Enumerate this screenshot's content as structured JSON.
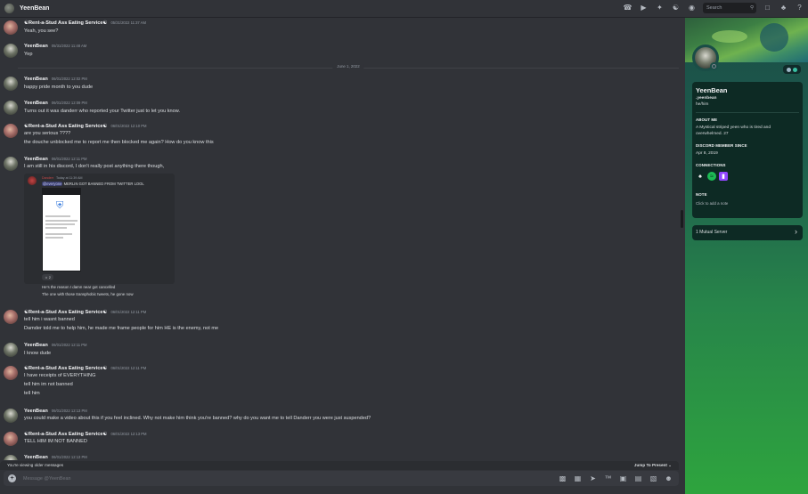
{
  "window": {
    "title": "YeenBean",
    "search_placeholder": "Search"
  },
  "header_icons": [
    "phone-icon",
    "video-icon",
    "pin-icon",
    "add-friend-icon",
    "profile-toggle-icon",
    "inbox-icon",
    "help-icon"
  ],
  "date_divider": "June 1, 2022",
  "messages": [
    {
      "author": "☯Rent-a-Stud Ass Eating Service☯",
      "time": "05/31/2022 11:37 AM",
      "lines": [
        "Yeah, you see?"
      ]
    },
    {
      "author": "YeenBean",
      "time": "05/31/2022 11:48 AM",
      "lines": [
        "Yep"
      ]
    },
    {
      "author": "YeenBean",
      "time": "06/01/2022 12:02 PM",
      "lines": [
        "happy pride month to you dude"
      ]
    },
    {
      "author": "YeenBean",
      "time": "06/01/2022 12:09 PM",
      "lines": [
        "Turns out it was danderr who reported your Twitter just to let you know."
      ]
    },
    {
      "author": "☯Rent-a-Stud Ass Eating Service☯",
      "time": "06/01/2022 12:10 PM",
      "lines": [
        "are you serious ????",
        "the douche unblocked me to report me then blocked me again? How do you know this"
      ]
    },
    {
      "author": "YeenBean",
      "time": "06/01/2022 12:11 PM",
      "lines": [
        "I am still in his discord, I don't really post anything there though,"
      ]
    },
    {
      "author": "☯Rent-a-Stud Ass Eating Service☯",
      "time": "06/01/2022 12:11 PM",
      "lines": [
        "tell him i wasnt banned",
        "Damder told me to help him, he made me frame people for him HE is the enemy, not me"
      ]
    },
    {
      "author": "YeenBean",
      "time": "06/01/2022 12:11 PM",
      "lines": [
        "I know dude"
      ]
    },
    {
      "author": "☯Rent-a-Stud Ass Eating Service☯",
      "time": "06/01/2022 12:11 PM",
      "lines": [
        "I have receipts of EVERYTHING",
        "tell him im not banned",
        "tell him"
      ]
    },
    {
      "author": "YeenBean",
      "time": "06/01/2022 12:13 PM",
      "lines": [
        "you could make a video about this if you feel inclined. Why not make him think you're banned? why do you want me to tell Danderr you were just suspended?"
      ]
    },
    {
      "author": "☯Rent-a-Stud Ass Eating Service☯",
      "time": "06/01/2022 12:13 PM",
      "lines": [
        "TELL HIM IM NOT BANNED"
      ]
    },
    {
      "author": "YeenBean",
      "time": "06/01/2022 12:13 PM",
      "lines": []
    }
  ],
  "embed": {
    "author": "Danderr",
    "time": "Today at 11:39 AM",
    "mention": "@everyone",
    "text": " MERLIN GOT BANNED FROM TWITTER LOOL",
    "reaction_count": "2",
    "caption1": "He's the reason I damn near got cancelled",
    "caption2": "The one with those transphobic tweets, he gone now"
  },
  "notice": {
    "text": "You're viewing older messages",
    "jump": "Jump To Present"
  },
  "composer": {
    "placeholder": "Message @YeenBean"
  },
  "profile": {
    "display_name": "YeenBean",
    "username": ".yeenbean",
    "pronouns": "he/him",
    "about_title": "ABOUT ME",
    "about": "A Mystical striped yeen who is tired and overwhelmed. 27",
    "member_since_title": "DISCORD MEMBER SINCE",
    "member_since": "Apr 8, 2019",
    "connections_title": "CONNECTIONS",
    "connections": [
      "playstation-icon",
      "spotify-icon",
      "twitch-icon"
    ],
    "note_title": "NOTE",
    "note_placeholder": "Click to add a note",
    "mutual": "1 Mutual Server",
    "accent": "#2ea43e"
  }
}
